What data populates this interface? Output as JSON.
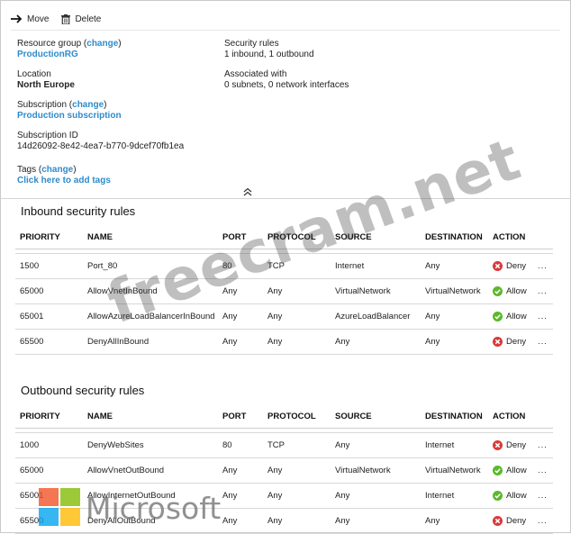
{
  "toolbar": {
    "move": "Move",
    "delete": "Delete"
  },
  "essentials": {
    "resource_group": {
      "label": "Resource group",
      "change": "change",
      "value": "ProductionRG"
    },
    "location": {
      "label": "Location",
      "value": "North Europe"
    },
    "subscription": {
      "label": "Subscription",
      "change": "change",
      "value": "Production subscription"
    },
    "subscription_id": {
      "label": "Subscription ID",
      "value": "14d26092-8e42-4ea7-b770-9dcef70fb1ea"
    },
    "tags": {
      "label": "Tags",
      "change": "change",
      "value": "Click here to add tags"
    },
    "security_rules": {
      "label": "Security rules",
      "value": "1 inbound, 1 outbound"
    },
    "associated": {
      "label": "Associated with",
      "value": "0 subnets, 0 network interfaces"
    }
  },
  "columns": [
    "PRIORITY",
    "NAME",
    "PORT",
    "PROTOCOL",
    "SOURCE",
    "DESTINATION",
    "ACTION"
  ],
  "inbound": {
    "title": "Inbound security rules",
    "rows": [
      {
        "priority": "1500",
        "name": "Port_80",
        "port": "80",
        "protocol": "TCP",
        "source": "Internet",
        "destination": "Any",
        "action": "Deny",
        "more": "..."
      },
      {
        "priority": "65000",
        "name": "AllowVnetInBound",
        "port": "Any",
        "protocol": "Any",
        "source": "VirtualNetwork",
        "destination": "VirtualNetwork",
        "action": "Allow",
        "more": "..."
      },
      {
        "priority": "65001",
        "name": "AllowAzureLoadBalancerInBound",
        "port": "Any",
        "protocol": "Any",
        "source": "AzureLoadBalancer",
        "destination": "Any",
        "action": "Allow",
        "more": "..."
      },
      {
        "priority": "65500",
        "name": "DenyAllInBound",
        "port": "Any",
        "protocol": "Any",
        "source": "Any",
        "destination": "Any",
        "action": "Deny",
        "more": "..."
      }
    ]
  },
  "outbound": {
    "title": "Outbound security rules",
    "rows": [
      {
        "priority": "1000",
        "name": "DenyWebSites",
        "port": "80",
        "protocol": "TCP",
        "source": "Any",
        "destination": "Internet",
        "action": "Deny",
        "more": "..."
      },
      {
        "priority": "65000",
        "name": "AllowVnetOutBound",
        "port": "Any",
        "protocol": "Any",
        "source": "VirtualNetwork",
        "destination": "VirtualNetwork",
        "action": "Allow",
        "more": "..."
      },
      {
        "priority": "65001",
        "name": "AllowInternetOutBound",
        "port": "Any",
        "protocol": "Any",
        "source": "Any",
        "destination": "Internet",
        "action": "Allow",
        "more": "..."
      },
      {
        "priority": "65500",
        "name": "DenyAllOutBound",
        "port": "Any",
        "protocol": "Any",
        "source": "Any",
        "destination": "Any",
        "action": "Deny",
        "more": "..."
      }
    ]
  },
  "watermarks": {
    "freecram": "freecram.net",
    "microsoft": "Microsoft"
  },
  "colors": {
    "link": "#2e8bcb",
    "deny": "#d93a3a",
    "allow": "#5cb82e"
  }
}
